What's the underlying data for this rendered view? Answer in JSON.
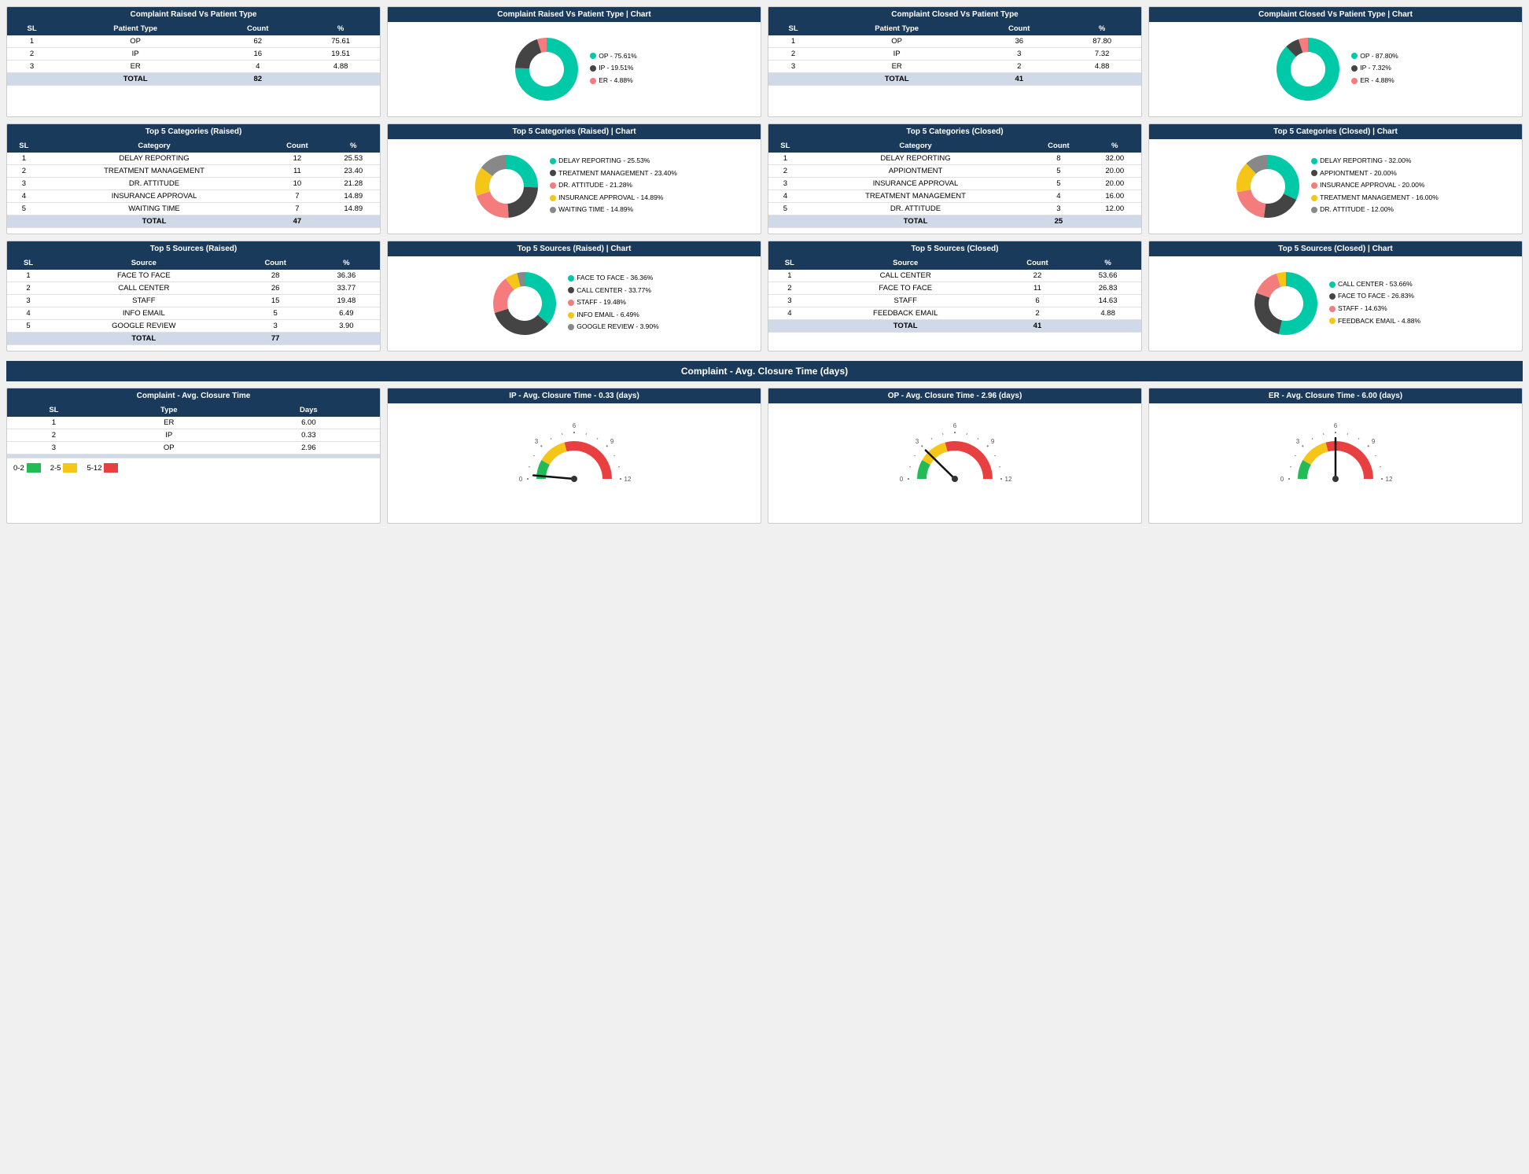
{
  "complainRaisedPatient": {
    "title": "Complaint Raised Vs Patient Type",
    "chartTitle": "Complaint Raised Vs Patient Type | Chart",
    "headers": [
      "SL",
      "Patient Type",
      "Count",
      "%"
    ],
    "rows": [
      [
        "1",
        "OP",
        "62",
        "75.61"
      ],
      [
        "2",
        "IP",
        "16",
        "19.51"
      ],
      [
        "3",
        "ER",
        "4",
        "4.88"
      ]
    ],
    "total": [
      "",
      "TOTAL",
      "82",
      ""
    ],
    "legend": [
      {
        "label": "OP - 75.61%",
        "color": "#00c9a7"
      },
      {
        "label": "IP - 19.51%",
        "color": "#444444"
      },
      {
        "label": "ER - 4.88%",
        "color": "#f47c7c"
      }
    ],
    "donut": [
      {
        "pct": 75.61,
        "color": "#00c9a7"
      },
      {
        "pct": 19.51,
        "color": "#444444"
      },
      {
        "pct": 4.88,
        "color": "#f47c7c"
      }
    ]
  },
  "complainClosedPatient": {
    "title": "Complaint Closed Vs Patient Type",
    "chartTitle": "Complaint Closed Vs Patient Type | Chart",
    "headers": [
      "SL",
      "Patient Type",
      "Count",
      "%"
    ],
    "rows": [
      [
        "1",
        "OP",
        "36",
        "87.80"
      ],
      [
        "2",
        "IP",
        "3",
        "7.32"
      ],
      [
        "3",
        "ER",
        "2",
        "4.88"
      ]
    ],
    "total": [
      "",
      "TOTAL",
      "41",
      ""
    ],
    "legend": [
      {
        "label": "OP - 87.80%",
        "color": "#00c9a7"
      },
      {
        "label": "IP - 7.32%",
        "color": "#444444"
      },
      {
        "label": "ER - 4.88%",
        "color": "#f47c7c"
      }
    ],
    "donut": [
      {
        "pct": 87.8,
        "color": "#00c9a7"
      },
      {
        "pct": 7.32,
        "color": "#444444"
      },
      {
        "pct": 4.88,
        "color": "#f47c7c"
      }
    ]
  },
  "top5CategoriesRaised": {
    "title": "Top 5 Categories (Raised)",
    "chartTitle": "Top 5 Categories (Raised) | Chart",
    "headers": [
      "SL",
      "Category",
      "Count",
      "%"
    ],
    "rows": [
      [
        "1",
        "DELAY REPORTING",
        "12",
        "25.53"
      ],
      [
        "2",
        "TREATMENT MANAGEMENT",
        "11",
        "23.40"
      ],
      [
        "3",
        "DR. ATTITUDE",
        "10",
        "21.28"
      ],
      [
        "4",
        "INSURANCE APPROVAL",
        "7",
        "14.89"
      ],
      [
        "5",
        "WAITING TIME",
        "7",
        "14.89"
      ]
    ],
    "total": [
      "",
      "TOTAL",
      "47",
      ""
    ],
    "legend": [
      {
        "label": "DELAY REPORTING - 25.53%",
        "color": "#00c9a7"
      },
      {
        "label": "TREATMENT MANAGEMENT - 23.40%",
        "color": "#444444"
      },
      {
        "label": "DR. ATTITUDE - 21.28%",
        "color": "#f47c7c"
      },
      {
        "label": "INSURANCE APPROVAL - 14.89%",
        "color": "#f5c518"
      },
      {
        "label": "WAITING TIME - 14.89%",
        "color": "#888888"
      }
    ],
    "donut": [
      {
        "pct": 25.53,
        "color": "#00c9a7"
      },
      {
        "pct": 23.4,
        "color": "#444444"
      },
      {
        "pct": 21.28,
        "color": "#f47c7c"
      },
      {
        "pct": 14.89,
        "color": "#f5c518"
      },
      {
        "pct": 14.89,
        "color": "#888888"
      }
    ]
  },
  "top5CategoriesClosed": {
    "title": "Top 5 Categories (Closed)",
    "chartTitle": "Top 5 Categories (Closed) | Chart",
    "headers": [
      "SL",
      "Category",
      "Count",
      "%"
    ],
    "rows": [
      [
        "1",
        "DELAY REPORTING",
        "8",
        "32.00"
      ],
      [
        "2",
        "APPIONTMENT",
        "5",
        "20.00"
      ],
      [
        "3",
        "INSURANCE APPROVAL",
        "5",
        "20.00"
      ],
      [
        "4",
        "TREATMENT MANAGEMENT",
        "4",
        "16.00"
      ],
      [
        "5",
        "DR. ATTITUDE",
        "3",
        "12.00"
      ]
    ],
    "total": [
      "",
      "TOTAL",
      "25",
      ""
    ],
    "legend": [
      {
        "label": "DELAY REPORTING - 32.00%",
        "color": "#00c9a7"
      },
      {
        "label": "APPIONTMENT - 20.00%",
        "color": "#444444"
      },
      {
        "label": "INSURANCE APPROVAL - 20.00%",
        "color": "#f47c7c"
      },
      {
        "label": "TREATMENT MANAGEMENT - 16.00%",
        "color": "#f5c518"
      },
      {
        "label": "DR. ATTITUDE - 12.00%",
        "color": "#888888"
      }
    ],
    "donut": [
      {
        "pct": 32.0,
        "color": "#00c9a7"
      },
      {
        "pct": 20.0,
        "color": "#444444"
      },
      {
        "pct": 20.0,
        "color": "#f47c7c"
      },
      {
        "pct": 16.0,
        "color": "#f5c518"
      },
      {
        "pct": 12.0,
        "color": "#888888"
      }
    ]
  },
  "top5SourcesRaised": {
    "title": "Top 5 Sources (Raised)",
    "chartTitle": "Top 5 Sources (Raised) | Chart",
    "headers": [
      "SL",
      "Source",
      "Count",
      "%"
    ],
    "rows": [
      [
        "1",
        "FACE TO FACE",
        "28",
        "36.36"
      ],
      [
        "2",
        "CALL CENTER",
        "26",
        "33.77"
      ],
      [
        "3",
        "STAFF",
        "15",
        "19.48"
      ],
      [
        "4",
        "INFO EMAIL",
        "5",
        "6.49"
      ],
      [
        "5",
        "GOOGLE REVIEW",
        "3",
        "3.90"
      ]
    ],
    "total": [
      "",
      "TOTAL",
      "77",
      ""
    ],
    "legend": [
      {
        "label": "FACE TO FACE - 36.36%",
        "color": "#00c9a7"
      },
      {
        "label": "CALL CENTER - 33.77%",
        "color": "#444444"
      },
      {
        "label": "STAFF - 19.48%",
        "color": "#f47c7c"
      },
      {
        "label": "INFO EMAIL - 6.49%",
        "color": "#f5c518"
      },
      {
        "label": "GOOGLE REVIEW - 3.90%",
        "color": "#888888"
      }
    ],
    "donut": [
      {
        "pct": 36.36,
        "color": "#00c9a7"
      },
      {
        "pct": 33.77,
        "color": "#444444"
      },
      {
        "pct": 19.48,
        "color": "#f47c7c"
      },
      {
        "pct": 6.49,
        "color": "#f5c518"
      },
      {
        "pct": 3.9,
        "color": "#888888"
      }
    ]
  },
  "top5SourcesClosed": {
    "title": "Top 5 Sources (Closed)",
    "chartTitle": "Top 5 Sources (Closed) | Chart",
    "headers": [
      "SL",
      "Source",
      "Count",
      "%"
    ],
    "rows": [
      [
        "1",
        "CALL CENTER",
        "22",
        "53.66"
      ],
      [
        "2",
        "FACE TO FACE",
        "11",
        "26.83"
      ],
      [
        "3",
        "STAFF",
        "6",
        "14.63"
      ],
      [
        "4",
        "FEEDBACK EMAIL",
        "2",
        "4.88"
      ]
    ],
    "total": [
      "",
      "TOTAL",
      "41",
      ""
    ],
    "legend": [
      {
        "label": "CALL CENTER - 53.66%",
        "color": "#00c9a7"
      },
      {
        "label": "FACE TO FACE - 26.83%",
        "color": "#444444"
      },
      {
        "label": "STAFF - 14.63%",
        "color": "#f47c7c"
      },
      {
        "label": "FEEDBACK EMAIL - 4.88%",
        "color": "#f5c518"
      }
    ],
    "donut": [
      {
        "pct": 53.66,
        "color": "#00c9a7"
      },
      {
        "pct": 26.83,
        "color": "#444444"
      },
      {
        "pct": 14.63,
        "color": "#f47c7c"
      },
      {
        "pct": 4.88,
        "color": "#f5c518"
      }
    ]
  },
  "avgClosureSection": {
    "sectionTitle": "Complaint - Avg. Closure Time (days)",
    "tableTitle": "Complaint - Avg. Closure Time",
    "tableHeaders": [
      "SL",
      "Type",
      "Days"
    ],
    "tableRows": [
      [
        "1",
        "ER",
        "6.00"
      ],
      [
        "2",
        "IP",
        "0.33"
      ],
      [
        "3",
        "OP",
        "2.96"
      ]
    ],
    "legendItems": [
      {
        "range": "0-2",
        "color": "#22bb55"
      },
      {
        "range": "2-5",
        "color": "#f5c518"
      },
      {
        "range": "5-12",
        "color": "#e84040"
      }
    ],
    "gauges": [
      {
        "title": "IP - Avg. Closure Time - 0.33 (days)",
        "value": 0.33,
        "max": 12,
        "needleAngle": -70
      },
      {
        "title": "OP - Avg. Closure Time - 2.96 (days)",
        "value": 2.96,
        "max": 12,
        "needleAngle": -20
      },
      {
        "title": "ER - Avg. Closure Time - 6.00 (days)",
        "value": 6.0,
        "max": 12,
        "needleAngle": 20
      }
    ]
  }
}
